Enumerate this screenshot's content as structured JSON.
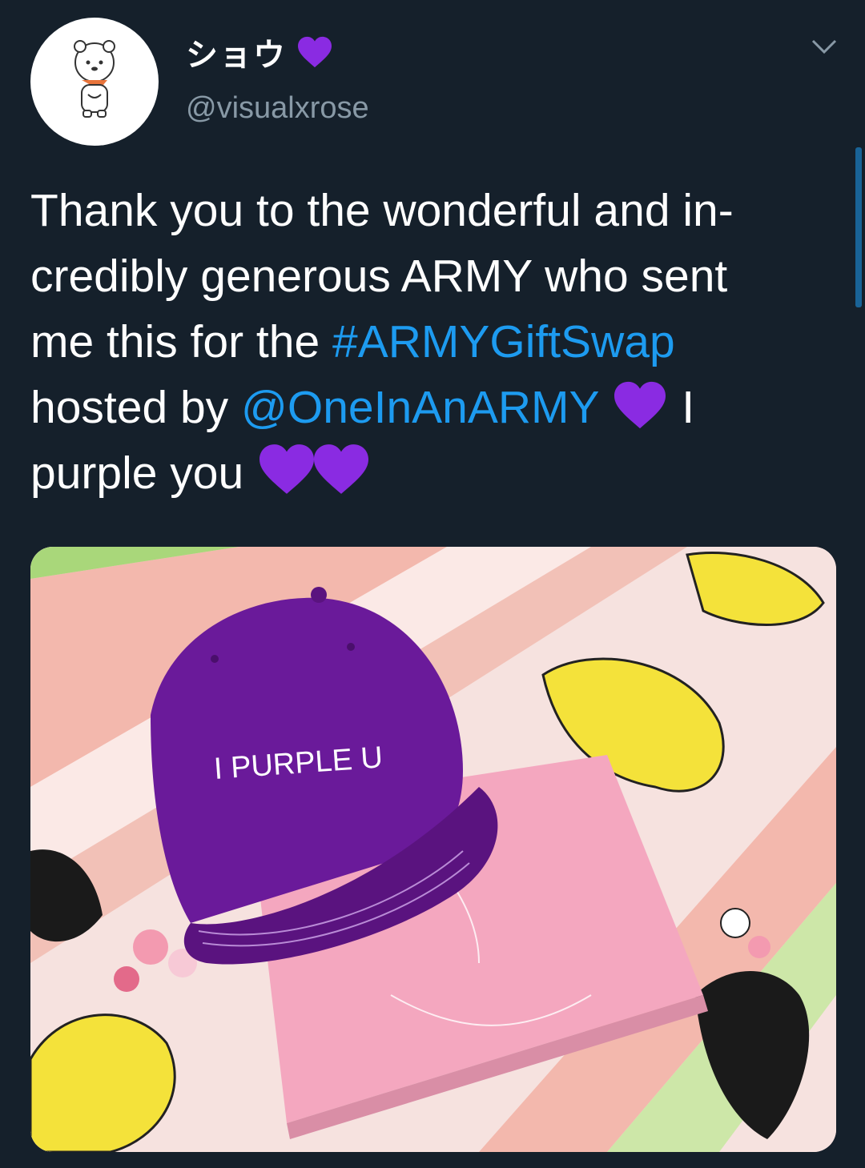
{
  "tweet": {
    "author": {
      "display_name": "ショウ",
      "handle": "@visualxrose",
      "avatar_icon": "rj-character-avatar-icon",
      "name_emoji": "purple-heart-icon"
    },
    "menu_icon": "chevron-down-icon",
    "text": {
      "line1": "Thank you to the wonderful and in-",
      "line2": "credibly generous ARMY who sent",
      "line3_prefix": "me this for the ",
      "hashtag": "#ARMYGiftSwap",
      "line4_prefix": "hosted by ",
      "mention": "@OneInAnARMY",
      "line4_suffix": " I",
      "line5": "purple you"
    },
    "colors": {
      "background": "#15202b",
      "link": "#1d9bf0",
      "secondary_text": "#8899a6",
      "heart": "#8a2be2"
    },
    "photo": {
      "cap_text": "I PURPLE U",
      "cap_color": "#6a1a9a",
      "album_color": "#f4a7bf"
    }
  }
}
